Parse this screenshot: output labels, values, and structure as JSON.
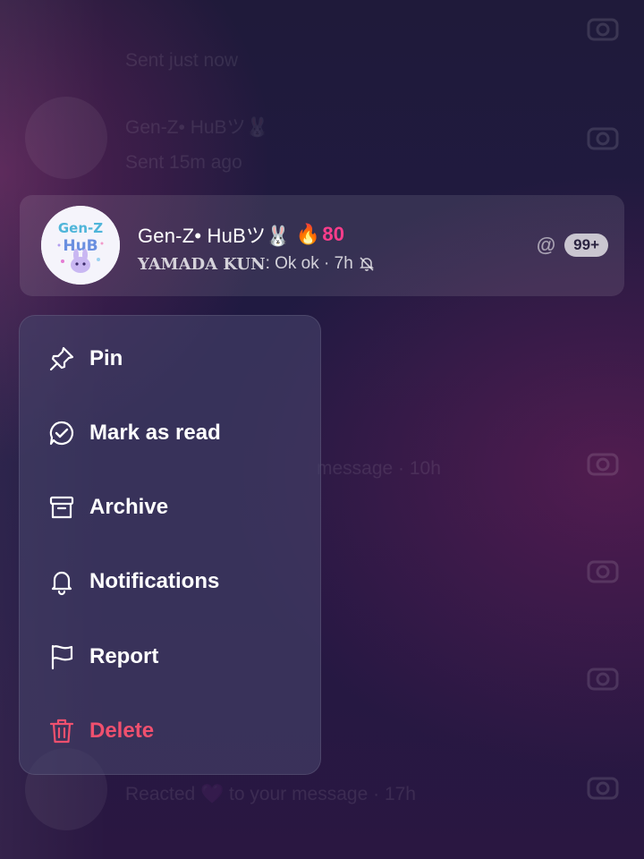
{
  "background": {
    "rows": [
      {
        "title": "",
        "sub": "Sent just now"
      },
      {
        "title": "Gen-Z• HuBツ🐰",
        "sub": "Sent 15m ago"
      },
      {
        "title": "",
        "sub": "message · 10h"
      },
      {
        "title": "",
        "sub": "Reacted 💜 to your message · 17h"
      }
    ]
  },
  "chat": {
    "title": "Gen-Z• HuBツ🐰",
    "streak_icon": "🔥",
    "streak_count": "80",
    "sender": "YAMADA KUN",
    "message": ": Ok ok · 7h",
    "mention_icon": "@",
    "unread_count": "99+",
    "avatar_text_top": "Gen-Z",
    "avatar_text_bottom": "HuB",
    "muted_icon": "bell-off-icon"
  },
  "menu": {
    "items": [
      {
        "label": "Pin",
        "icon": "pin-icon"
      },
      {
        "label": "Mark as read",
        "icon": "mark-read-icon"
      },
      {
        "label": "Archive",
        "icon": "archive-icon"
      },
      {
        "label": "Notifications",
        "icon": "bell-icon"
      },
      {
        "label": "Report",
        "icon": "flag-icon"
      },
      {
        "label": "Delete",
        "icon": "trash-icon"
      }
    ]
  },
  "colors": {
    "danger": "#f0506e",
    "streak": "#ff3d8b"
  }
}
